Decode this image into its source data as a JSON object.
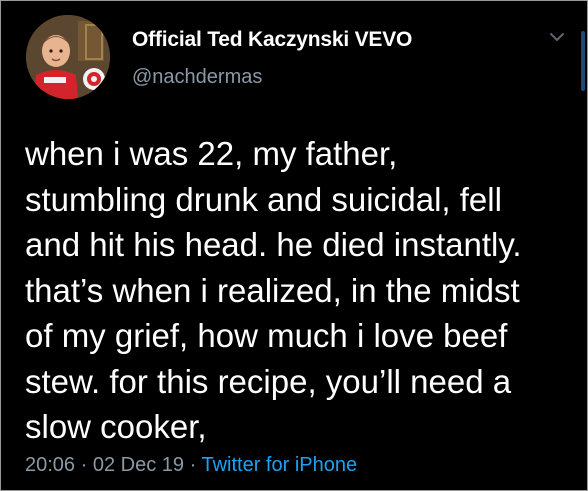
{
  "tweet": {
    "author": {
      "display_name": "Official Ted Kaczynski VEVO",
      "handle": "@nachdermas"
    },
    "text_lines": [
      "when i was 22, my father,",
      "stumbling drunk and suicidal, fell",
      "and hit his head. he died instantly.",
      "that’s when i realized, in the midst",
      "of my grief, how much i love beef",
      "stew. for this recipe, you’ll need a",
      "slow cooker,"
    ],
    "meta": {
      "time": "20:06",
      "separator": "·",
      "date": "02 Dec 19",
      "source": "Twitter for iPhone"
    },
    "icons": {
      "menu": "chevron-down-icon",
      "avatar": "avatar"
    },
    "colors": {
      "background": "#000000",
      "text": "#ffffff",
      "muted": "#8b98a5",
      "link": "#1da1f2"
    }
  }
}
